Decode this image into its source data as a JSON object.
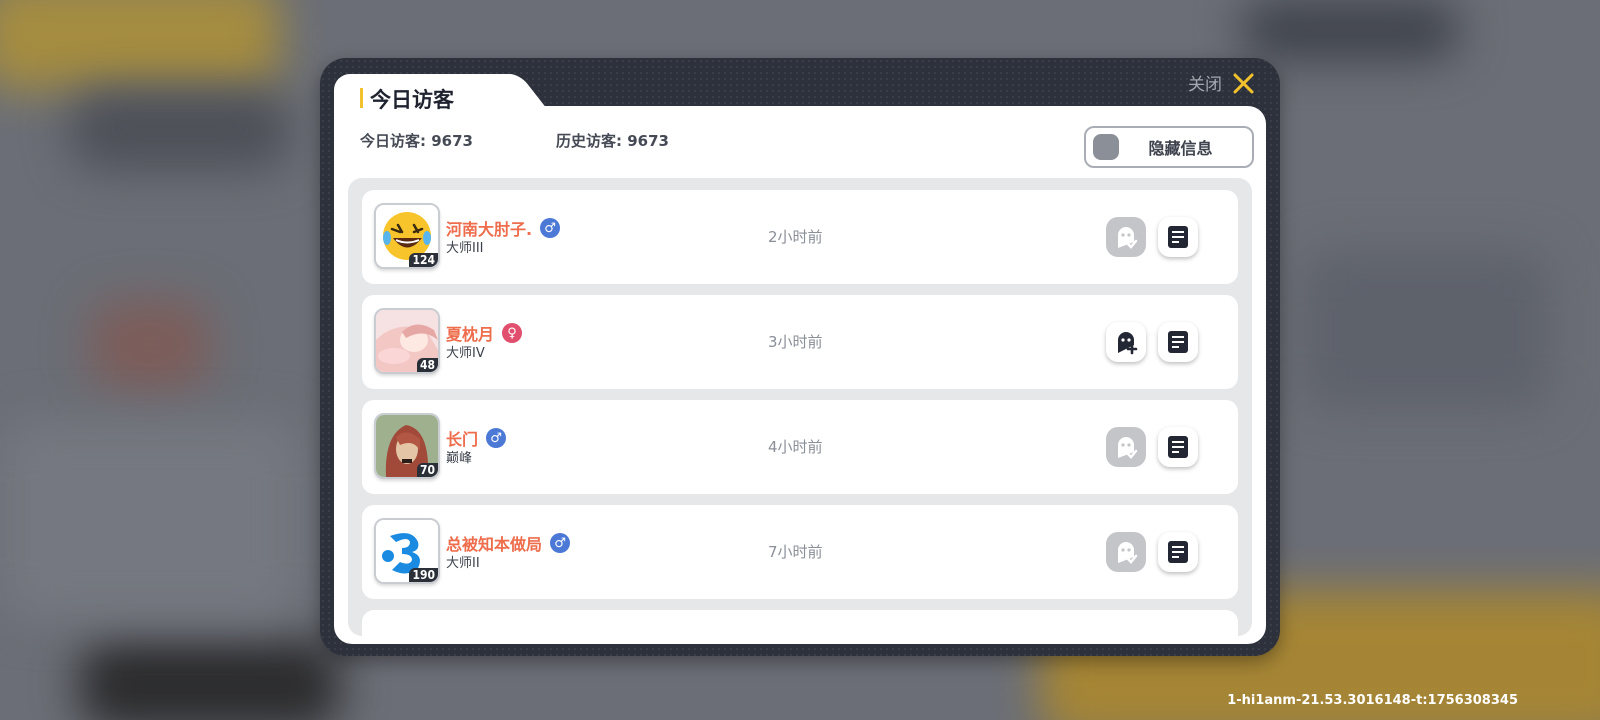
{
  "dialog": {
    "tab_title": "今日访客",
    "close_label": "关闭",
    "today_visitors": "今日访客: 9673",
    "history_visitors": "历史访客: 9673",
    "hide_info_label": "隐藏信息"
  },
  "visitors": [
    {
      "name": "河南大肘子.",
      "gender": "male",
      "gender_symbol": "♂",
      "rank": "大师III",
      "level": "124",
      "time": "2小时前",
      "friend_status": "added",
      "avatar": "laughing-emoji"
    },
    {
      "name": "夏枕月",
      "gender": "female",
      "gender_symbol": "♀",
      "rank": "大师IV",
      "level": "48",
      "time": "3小时前",
      "friend_status": "add",
      "avatar": "anime-girl"
    },
    {
      "name": "长门",
      "gender": "male",
      "gender_symbol": "♂",
      "rank": "巅峰",
      "level": "70",
      "time": "4小时前",
      "friend_status": "added",
      "avatar": "red-hair-character"
    },
    {
      "name": "总被知本做局",
      "gender": "male",
      "gender_symbol": "♂",
      "rank": "大师II",
      "level": "190",
      "time": "7小时前",
      "friend_status": "added",
      "avatar": "blue-logo"
    }
  ],
  "footer": {
    "build_id": "1-hi1anm-21.53.3016148-t:1756308345"
  },
  "colors": {
    "accent": "#f2c12e",
    "name": "#ee6d4c",
    "male": "#4c78d6",
    "female": "#e04f6e"
  }
}
